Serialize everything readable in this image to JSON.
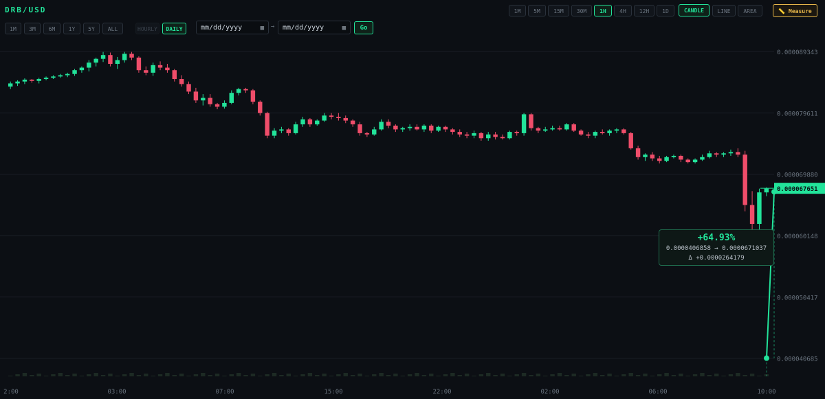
{
  "pair": "DRB/USD",
  "ranges": [
    "1M",
    "3M",
    "6M",
    "1Y",
    "5Y",
    "ALL"
  ],
  "modes": [
    "HOURLY",
    "DAILY"
  ],
  "date_placeholder": "mm/dd/yyyy",
  "go_label": "Go",
  "intervals": [
    "1M",
    "5M",
    "15M",
    "30M",
    "1H",
    "4H",
    "12H",
    "1D"
  ],
  "active_interval": "1H",
  "chart_types": [
    "CANDLE",
    "LINE",
    "AREA"
  ],
  "active_chart_type": "CANDLE",
  "measure_label": "Measure",
  "colors": {
    "up": "#22e39a",
    "down": "#ef4d6a",
    "grid": "#1a1f26",
    "axis": "#6b7580"
  },
  "tooltip": {
    "pct": "+64.93%",
    "range": "0.0000406858 → 0.0000671037",
    "delta": "Δ +0.0000264179"
  },
  "chart_data": {
    "type": "candlestick",
    "title": "DRB/USD",
    "y_ticks": [
      "0.000089343",
      "0.000079611",
      "0.000069880",
      "0.000060148",
      "0.000050417",
      "0.000040685"
    ],
    "y_tick_values": [
      8.9343e-05,
      7.9611e-05,
      6.988e-05,
      6.0148e-05,
      5.0417e-05,
      4.0685e-05
    ],
    "x_ticks": [
      "2:00",
      "03:00",
      "07:00",
      "15:00",
      "22:00",
      "02:00",
      "06:00",
      "10:00"
    ],
    "last_price_label": "0.000067651",
    "last_price": 6.7651e-05,
    "measure": {
      "from": 4.06858e-05,
      "to": 6.71037e-05
    },
    "ylim": [
      3.78e-05,
      9.1e-05
    ],
    "candles": [
      [
        8.38e-05,
        8.46e-05,
        8.34e-05,
        8.43e-05
      ],
      [
        8.43e-05,
        8.48e-05,
        8.39e-05,
        8.46e-05
      ],
      [
        8.46e-05,
        8.51e-05,
        8.42e-05,
        8.49e-05
      ],
      [
        8.49e-05,
        8.5e-05,
        8.44e-05,
        8.47e-05
      ],
      [
        8.47e-05,
        8.52e-05,
        8.43e-05,
        8.5e-05
      ],
      [
        8.5e-05,
        8.54e-05,
        8.48e-05,
        8.52e-05
      ],
      [
        8.52e-05,
        8.56e-05,
        8.5e-05,
        8.54e-05
      ],
      [
        8.54e-05,
        8.58e-05,
        8.52e-05,
        8.56e-05
      ],
      [
        8.56e-05,
        8.6e-05,
        8.53e-05,
        8.58e-05
      ],
      [
        8.58e-05,
        8.66e-05,
        8.55e-05,
        8.64e-05
      ],
      [
        8.64e-05,
        8.7e-05,
        8.6e-05,
        8.68e-05
      ],
      [
        8.68e-05,
        8.8e-05,
        8.62e-05,
        8.76e-05
      ],
      [
        8.76e-05,
        8.84e-05,
        8.7e-05,
        8.82e-05
      ],
      [
        8.82e-05,
        8.93e-05,
        8.77e-05,
        8.88e-05
      ],
      [
        8.88e-05,
        8.92e-05,
        8.7e-05,
        8.74e-05
      ],
      [
        8.74e-05,
        8.85e-05,
        8.66e-05,
        8.8e-05
      ],
      [
        8.8e-05,
        8.93e-05,
        8.76e-05,
        8.9e-05
      ],
      [
        8.9e-05,
        8.93e-05,
        8.8e-05,
        8.84e-05
      ],
      [
        8.84e-05,
        8.86e-05,
        8.6e-05,
        8.64e-05
      ],
      [
        8.64e-05,
        8.7e-05,
        8.56e-05,
        8.6e-05
      ],
      [
        8.6e-05,
        8.76e-05,
        8.55e-05,
        8.72e-05
      ],
      [
        8.72e-05,
        8.78e-05,
        8.64e-05,
        8.68e-05
      ],
      [
        8.68e-05,
        8.74e-05,
        8.6e-05,
        8.64e-05
      ],
      [
        8.64e-05,
        8.66e-05,
        8.46e-05,
        8.5e-05
      ],
      [
        8.5e-05,
        8.56e-05,
        8.38e-05,
        8.42e-05
      ],
      [
        8.42e-05,
        8.46e-05,
        8.26e-05,
        8.3e-05
      ],
      [
        8.3e-05,
        8.36e-05,
        8.12e-05,
        8.16e-05
      ],
      [
        8.16e-05,
        8.26e-05,
        8.08e-05,
        8.2e-05
      ],
      [
        8.2e-05,
        8.26e-05,
        8.06e-05,
        8.1e-05
      ],
      [
        8.1e-05,
        8.12e-05,
        8.02e-05,
        8.06e-05
      ],
      [
        8.06e-05,
        8.16e-05,
        8.03e-05,
        8.12e-05
      ],
      [
        8.12e-05,
        8.32e-05,
        8.1e-05,
        8.28e-05
      ],
      [
        8.28e-05,
        8.36e-05,
        8.24e-05,
        8.34e-05
      ],
      [
        8.34e-05,
        8.36e-05,
        8.28e-05,
        8.32e-05
      ],
      [
        8.32e-05,
        8.34e-05,
        8.1e-05,
        8.14e-05
      ],
      [
        8.14e-05,
        8.16e-05,
        7.92e-05,
        7.96e-05
      ],
      [
        7.96e-05,
        7.98e-05,
        7.56e-05,
        7.6e-05
      ],
      [
        7.6e-05,
        7.72e-05,
        7.56e-05,
        7.68e-05
      ],
      [
        7.68e-05,
        7.74e-05,
        7.64e-05,
        7.7e-05
      ],
      [
        7.7e-05,
        7.72e-05,
        7.6e-05,
        7.64e-05
      ],
      [
        7.64e-05,
        7.82e-05,
        7.62e-05,
        7.78e-05
      ],
      [
        7.78e-05,
        7.9e-05,
        7.74e-05,
        7.86e-05
      ],
      [
        7.86e-05,
        7.88e-05,
        7.74e-05,
        7.78e-05
      ],
      [
        7.78e-05,
        7.86e-05,
        7.76e-05,
        7.84e-05
      ],
      [
        7.84e-05,
        7.96e-05,
        7.82e-05,
        7.92e-05
      ],
      [
        7.92e-05,
        7.96e-05,
        7.86e-05,
        7.9e-05
      ],
      [
        7.9e-05,
        7.96e-05,
        7.84e-05,
        7.88e-05
      ],
      [
        7.88e-05,
        7.92e-05,
        7.8e-05,
        7.84e-05
      ],
      [
        7.84e-05,
        7.86e-05,
        7.74e-05,
        7.78e-05
      ],
      [
        7.78e-05,
        7.82e-05,
        7.6e-05,
        7.64e-05
      ],
      [
        7.64e-05,
        7.66e-05,
        7.58e-05,
        7.62e-05
      ],
      [
        7.62e-05,
        7.74e-05,
        7.6e-05,
        7.7e-05
      ],
      [
        7.7e-05,
        7.86e-05,
        7.68e-05,
        7.82e-05
      ],
      [
        7.82e-05,
        7.86e-05,
        7.72e-05,
        7.76e-05
      ],
      [
        7.76e-05,
        7.78e-05,
        7.66e-05,
        7.7e-05
      ],
      [
        7.7e-05,
        7.74e-05,
        7.66e-05,
        7.72e-05
      ],
      [
        7.72e-05,
        7.78e-05,
        7.68e-05,
        7.74e-05
      ],
      [
        7.74e-05,
        7.78e-05,
        7.68e-05,
        7.7e-05
      ],
      [
        7.7e-05,
        7.78e-05,
        7.66e-05,
        7.76e-05
      ],
      [
        7.76e-05,
        7.78e-05,
        7.64e-05,
        7.68e-05
      ],
      [
        7.68e-05,
        7.76e-05,
        7.66e-05,
        7.74e-05
      ],
      [
        7.74e-05,
        7.76e-05,
        7.66e-05,
        7.7e-05
      ],
      [
        7.7e-05,
        7.72e-05,
        7.62e-05,
        7.66e-05
      ],
      [
        7.66e-05,
        7.7e-05,
        7.58e-05,
        7.62e-05
      ],
      [
        7.62e-05,
        7.66e-05,
        7.56e-05,
        7.6e-05
      ],
      [
        7.6e-05,
        7.68e-05,
        7.56e-05,
        7.64e-05
      ],
      [
        7.64e-05,
        7.66e-05,
        7.52e-05,
        7.56e-05
      ],
      [
        7.56e-05,
        7.66e-05,
        7.52e-05,
        7.62e-05
      ],
      [
        7.62e-05,
        7.66e-05,
        7.54e-05,
        7.58e-05
      ],
      [
        7.58e-05,
        7.62e-05,
        7.54e-05,
        7.56e-05
      ],
      [
        7.56e-05,
        7.68e-05,
        7.54e-05,
        7.66e-05
      ],
      [
        7.66e-05,
        7.68e-05,
        7.6e-05,
        7.64e-05
      ],
      [
        7.64e-05,
        7.96e-05,
        7.6e-05,
        7.94e-05
      ],
      [
        7.94e-05,
        7.96e-05,
        7.68e-05,
        7.72e-05
      ],
      [
        7.72e-05,
        7.74e-05,
        7.64e-05,
        7.68e-05
      ],
      [
        7.68e-05,
        7.74e-05,
        7.66e-05,
        7.7e-05
      ],
      [
        7.7e-05,
        7.76e-05,
        7.68e-05,
        7.72e-05
      ],
      [
        7.72e-05,
        7.76e-05,
        7.68e-05,
        7.7e-05
      ],
      [
        7.7e-05,
        7.8e-05,
        7.68e-05,
        7.78e-05
      ],
      [
        7.78e-05,
        7.8e-05,
        7.66e-05,
        7.68e-05
      ],
      [
        7.68e-05,
        7.7e-05,
        7.6e-05,
        7.62e-05
      ],
      [
        7.62e-05,
        7.66e-05,
        7.56e-05,
        7.6e-05
      ],
      [
        7.6e-05,
        7.68e-05,
        7.56e-05,
        7.66e-05
      ],
      [
        7.66e-05,
        7.7e-05,
        7.62e-05,
        7.64e-05
      ],
      [
        7.64e-05,
        7.7e-05,
        7.6e-05,
        7.68e-05
      ],
      [
        7.68e-05,
        7.72e-05,
        7.64e-05,
        7.7e-05
      ],
      [
        7.7e-05,
        7.72e-05,
        7.62e-05,
        7.64e-05
      ],
      [
        7.64e-05,
        7.66e-05,
        7.38e-05,
        7.4e-05
      ],
      [
        7.4e-05,
        7.44e-05,
        7.22e-05,
        7.26e-05
      ],
      [
        7.26e-05,
        7.32e-05,
        7.2e-05,
        7.3e-05
      ],
      [
        7.3e-05,
        7.34e-05,
        7.2e-05,
        7.24e-05
      ],
      [
        7.24e-05,
        7.28e-05,
        7.16e-05,
        7.2e-05
      ],
      [
        7.2e-05,
        7.28e-05,
        7.18e-05,
        7.26e-05
      ],
      [
        7.26e-05,
        7.3e-05,
        7.24e-05,
        7.28e-05
      ],
      [
        7.28e-05,
        7.3e-05,
        7.18e-05,
        7.22e-05
      ],
      [
        7.22e-05,
        7.24e-05,
        7.16e-05,
        7.18e-05
      ],
      [
        7.18e-05,
        7.24e-05,
        7.16e-05,
        7.22e-05
      ],
      [
        7.22e-05,
        7.3e-05,
        7.2e-05,
        7.26e-05
      ],
      [
        7.26e-05,
        7.36e-05,
        7.24e-05,
        7.32e-05
      ],
      [
        7.32e-05,
        7.34e-05,
        7.26e-05,
        7.3e-05
      ],
      [
        7.3e-05,
        7.34e-05,
        7.26e-05,
        7.32e-05
      ],
      [
        7.32e-05,
        7.38e-05,
        7.28e-05,
        7.34e-05
      ],
      [
        7.34e-05,
        7.4e-05,
        7.26e-05,
        7.3e-05
      ],
      [
        7.3e-05,
        7.36e-05,
        6.4e-05,
        6.5e-05
      ],
      [
        6.5e-05,
        6.72e-05,
        5.9e-05,
        6.2e-05
      ],
      [
        6.2e-05,
        6.76e-05,
        6e-05,
        6.7e-05
      ],
      [
        6.7e-05,
        6.78e-05,
        6.64e-05,
        6.76e-05
      ]
    ]
  }
}
